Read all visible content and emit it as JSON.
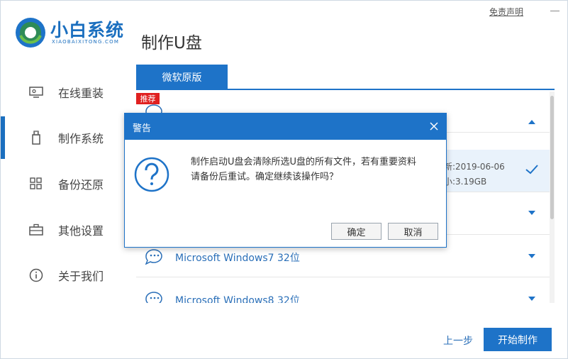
{
  "header": {
    "brand_name": "小白系统",
    "brand_sub": "XIAOBAIXITONG.COM",
    "page_title": "制作U盘",
    "disclaimer": "免责声明"
  },
  "sidebar": {
    "items": [
      {
        "label": "在线重装",
        "icon": "monitor-icon"
      },
      {
        "label": "制作系统",
        "icon": "usb-drive-icon",
        "active": true
      },
      {
        "label": "备份还原",
        "icon": "grid-icon"
      },
      {
        "label": "其他设置",
        "icon": "briefcase-icon"
      },
      {
        "label": "关于我们",
        "icon": "info-icon"
      }
    ]
  },
  "main": {
    "tab_label": "微软原版",
    "recommend_badge": "推荐",
    "list": [
      {
        "name": "",
        "detail_line1": "",
        "detail_line2": ""
      },
      {
        "name": "",
        "detail_line1": "新:2019-06-06",
        "detail_line2": "小:3.19GB",
        "selected": true
      },
      {
        "name": ""
      },
      {
        "name": "Microsoft Windows7 32位"
      },
      {
        "name": "Microsoft Windows8 32位"
      }
    ],
    "prev_label": "上一步",
    "start_label": "开始制作"
  },
  "dialog": {
    "title": "警告",
    "message_line1": "制作启动U盘会清除所选U盘的所有文件，若有重要资料",
    "message_line2": "请备份后重试。确定继续该操作吗？",
    "ok_label": "确定",
    "cancel_label": "取消"
  },
  "colors": {
    "accent": "#1e73c8",
    "badge": "#e02020"
  }
}
